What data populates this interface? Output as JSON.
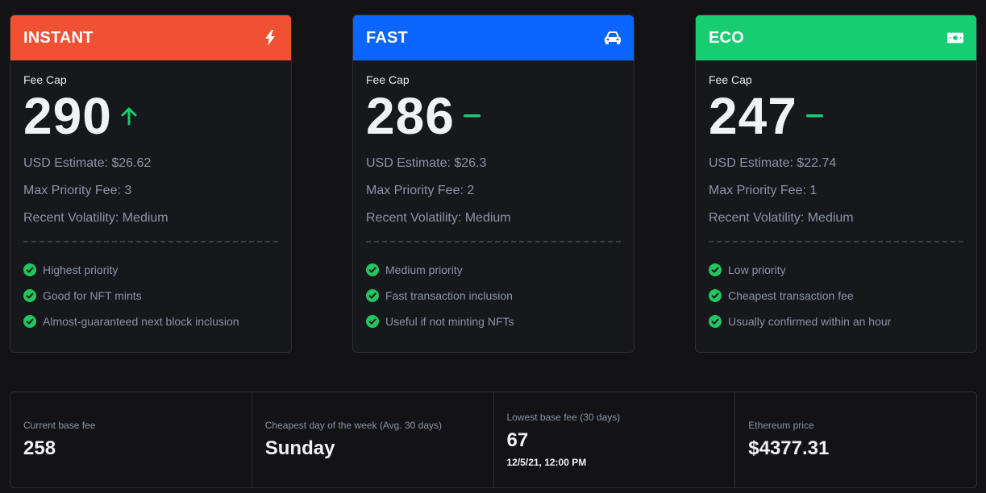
{
  "colors": {
    "instant": "#ef5132",
    "fast": "#0a66ff",
    "eco": "#16cd72",
    "check": "#22c55e",
    "trend": "#16cd72"
  },
  "cards": [
    {
      "title": "INSTANT",
      "icon": "lightning-icon",
      "fee_cap_label": "Fee Cap",
      "fee_cap": "290",
      "trend": "up-arrow-icon",
      "usd_estimate": "USD Estimate: $26.62",
      "max_priority_fee": "Max Priority Fee: 3",
      "recent_volatility": "Recent Volatility: Medium",
      "features": [
        "Highest priority",
        "Good for NFT mints",
        "Almost-guaranteed next block inclusion"
      ]
    },
    {
      "title": "FAST",
      "icon": "car-icon",
      "fee_cap_label": "Fee Cap",
      "fee_cap": "286",
      "trend": "dash-icon",
      "usd_estimate": "USD Estimate: $26.3",
      "max_priority_fee": "Max Priority Fee: 2",
      "recent_volatility": "Recent Volatility: Medium",
      "features": [
        "Medium priority",
        "Fast transaction inclusion",
        "Useful if not minting NFTs"
      ]
    },
    {
      "title": "ECO",
      "icon": "money-icon",
      "fee_cap_label": "Fee Cap",
      "fee_cap": "247",
      "trend": "dash-icon",
      "usd_estimate": "USD Estimate: $22.74",
      "max_priority_fee": "Max Priority Fee: 1",
      "recent_volatility": "Recent Volatility: Medium",
      "features": [
        "Low priority",
        "Cheapest transaction fee",
        "Usually confirmed within an hour"
      ]
    }
  ],
  "stats": [
    {
      "label": "Current base fee",
      "value": "258"
    },
    {
      "label": "Cheapest day of the week (Avg. 30 days)",
      "value": "Sunday"
    },
    {
      "label": "Lowest base fee (30 days)",
      "value": "67",
      "sub": "12/5/21, 12:00 PM"
    },
    {
      "label": "Ethereum price",
      "value": "$4377.31"
    }
  ]
}
